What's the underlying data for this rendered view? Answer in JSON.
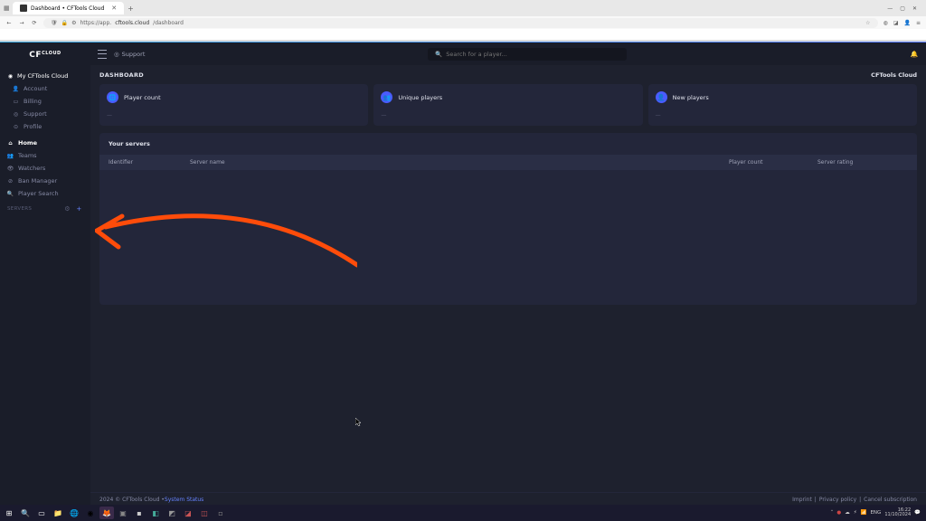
{
  "browser": {
    "tab_title": "Dashboard • CFTools Cloud",
    "url_prefix": "https://app.",
    "url_domain": "cftools.cloud",
    "url_path": "/dashboard"
  },
  "sidebar": {
    "logo_line1": "CF",
    "logo_line2": "CLOUD",
    "workspace": "My CFTools Cloud",
    "account": "Account",
    "billing": "Billing",
    "support": "Support",
    "profile": "Profile",
    "home": "Home",
    "teams": "Teams",
    "watchers": "Watchers",
    "ban_manager": "Ban Manager",
    "player_search": "Player Search",
    "servers_label": "SERVERS"
  },
  "topbar": {
    "support_link": "Support",
    "search_placeholder": "Search for a player..."
  },
  "page": {
    "title": "DASHBOARD",
    "brand": "CFTools Cloud"
  },
  "cards": [
    {
      "label": "Player count",
      "value": "—"
    },
    {
      "label": "Unique players",
      "value": "—"
    },
    {
      "label": "New players",
      "value": "—"
    }
  ],
  "servers": {
    "title": "Your servers",
    "columns": {
      "identifier": "Identifier",
      "server_name": "Server name",
      "player_count": "Player count",
      "server_rating": "Server rating"
    }
  },
  "footer": {
    "copyright": "2024 © CFTools Cloud • ",
    "system_status": "System Status",
    "imprint": "Imprint",
    "privacy": "Privacy policy",
    "cancel_sub": "Cancel subscription"
  },
  "taskbar": {
    "lang": "ENG",
    "time": "16:22",
    "date": "11/10/2024"
  },
  "colors": {
    "accent_arrow": "#ff4c0a",
    "accent_blue": "#6683ff"
  }
}
